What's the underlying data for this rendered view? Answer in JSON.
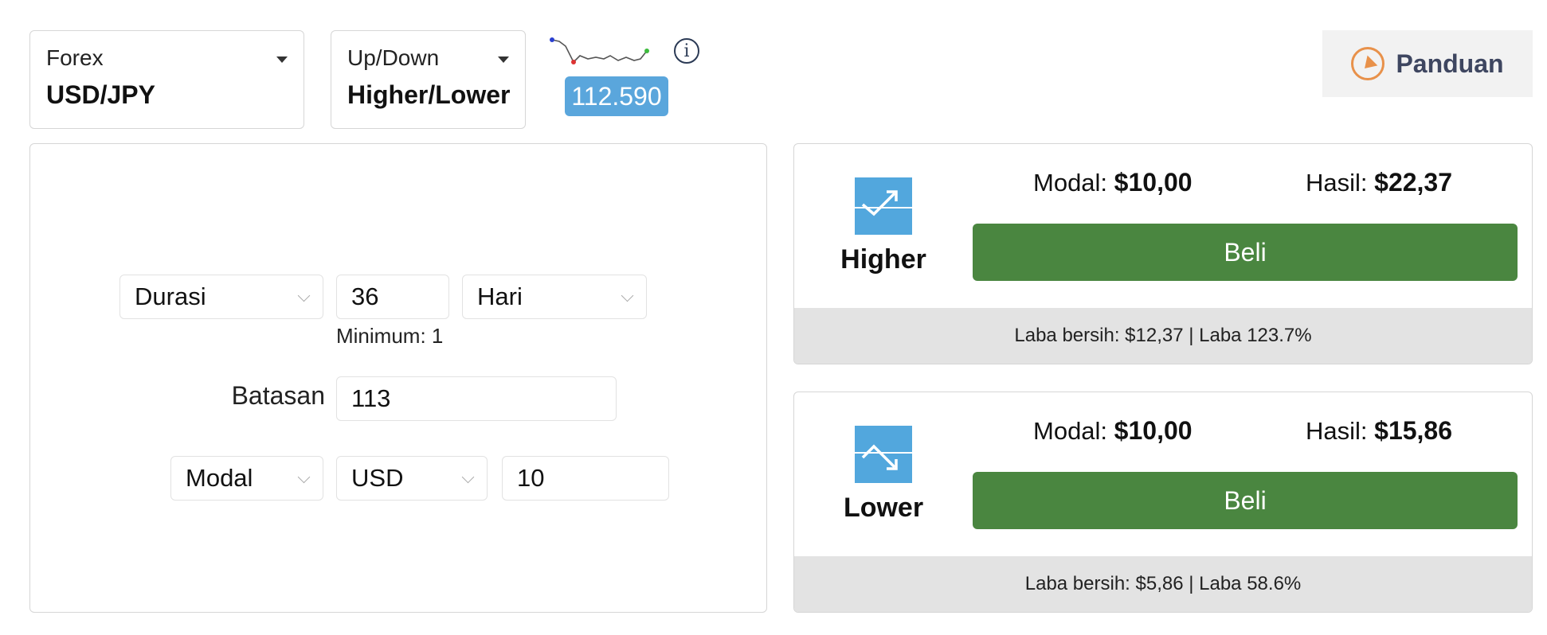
{
  "market": {
    "category": "Forex",
    "asset": "USD/JPY"
  },
  "option": {
    "category": "Up/Down",
    "type": "Higher/Lower"
  },
  "price": {
    "current": "112.590"
  },
  "guide": {
    "label": "Panduan"
  },
  "form": {
    "duration": {
      "label": "Durasi",
      "value": "36",
      "unit": "Hari",
      "minimum_text": "Minimum: 1"
    },
    "barrier": {
      "label": "Batasan",
      "value": "113"
    },
    "stake": {
      "label": "Modal",
      "currency": "USD",
      "value": "10"
    }
  },
  "contracts": [
    {
      "direction": "Higher",
      "stake_label": "Modal:",
      "stake_value": "$10,00",
      "payout_label": "Hasil:",
      "payout_value": "$22,37",
      "buy_label": "Beli",
      "footer": "Laba bersih: $12,37 | Laba 123.7%"
    },
    {
      "direction": "Lower",
      "stake_label": "Modal:",
      "stake_value": "$10,00",
      "payout_label": "Hasil:",
      "payout_value": "$15,86",
      "buy_label": "Beli",
      "footer": "Laba bersih: $5,86 | Laba 58.6%"
    }
  ],
  "colors": {
    "buy": "#4a8640",
    "price_badge": "#5aa6dc",
    "icon_tile": "#52a7dd",
    "guide_icon": "#e8914a"
  }
}
